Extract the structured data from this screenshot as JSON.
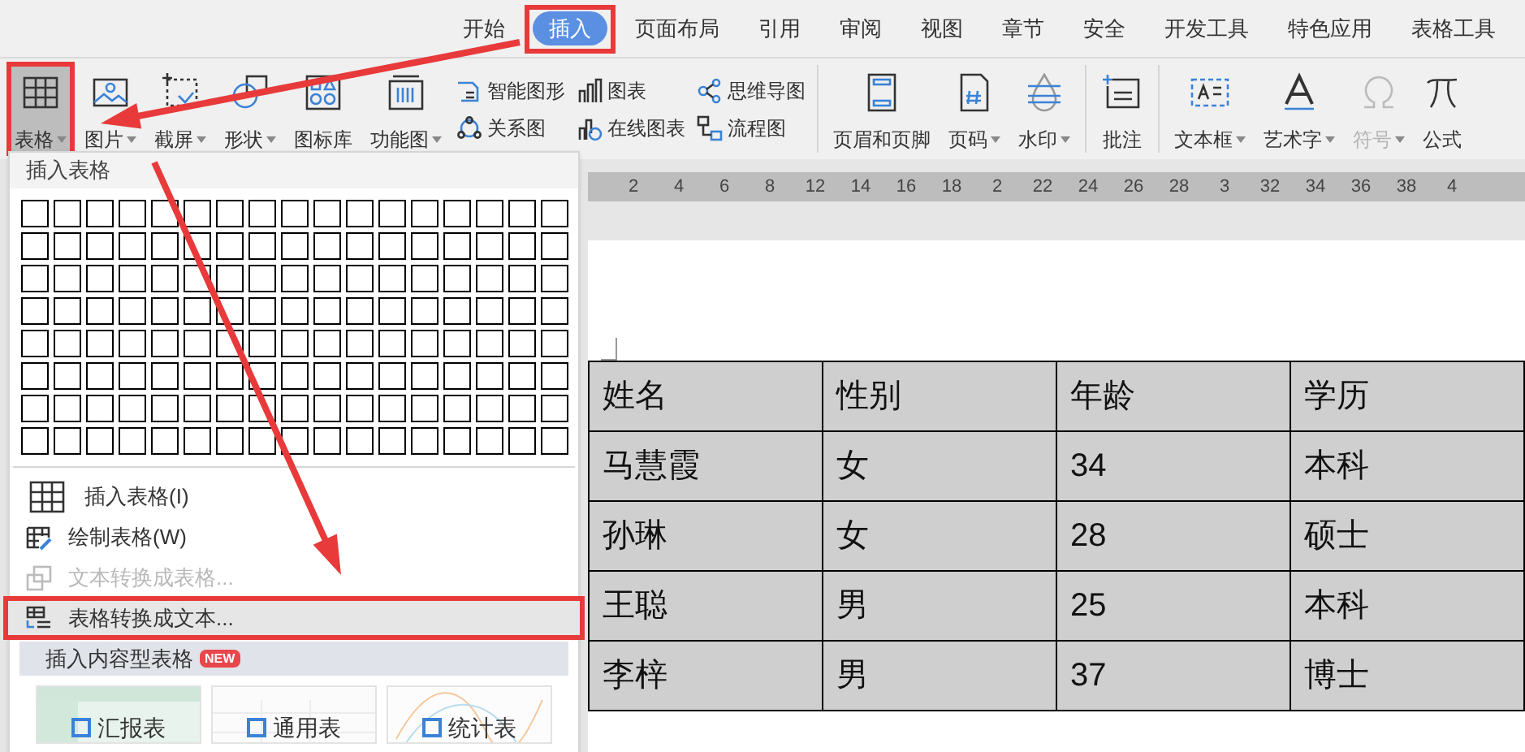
{
  "tabs": [
    {
      "label": "开始",
      "selected": false,
      "highlighted": false
    },
    {
      "label": "插入",
      "selected": true,
      "highlighted": true
    },
    {
      "label": "页面布局",
      "selected": false,
      "highlighted": false
    },
    {
      "label": "引用",
      "selected": false,
      "highlighted": false
    },
    {
      "label": "审阅",
      "selected": false,
      "highlighted": false
    },
    {
      "label": "视图",
      "selected": false,
      "highlighted": false
    },
    {
      "label": "章节",
      "selected": false,
      "highlighted": false
    },
    {
      "label": "安全",
      "selected": false,
      "highlighted": false
    },
    {
      "label": "开发工具",
      "selected": false,
      "highlighted": false
    },
    {
      "label": "特色应用",
      "selected": false,
      "highlighted": false
    },
    {
      "label": "表格工具",
      "selected": false,
      "highlighted": false
    }
  ],
  "toolbar": [
    {
      "kind": "big",
      "label": "表格",
      "caret": true,
      "pressed": true,
      "highlighted": true,
      "disabled": false
    },
    {
      "kind": "big",
      "label": "图片",
      "caret": true,
      "pressed": false,
      "highlighted": false,
      "disabled": false
    },
    {
      "kind": "big",
      "label": "截屏",
      "caret": true,
      "pressed": false,
      "highlighted": false,
      "disabled": false
    },
    {
      "kind": "big",
      "label": "形状",
      "caret": true,
      "pressed": false,
      "highlighted": false,
      "disabled": false
    },
    {
      "kind": "big",
      "label": "图标库",
      "caret": false,
      "pressed": false,
      "highlighted": false,
      "disabled": false
    },
    {
      "kind": "big",
      "label": "功能图",
      "caret": true,
      "pressed": false,
      "highlighted": false,
      "disabled": false
    },
    {
      "kind": "pair",
      "items": [
        "智能图形",
        "关系图"
      ]
    },
    {
      "kind": "pair",
      "items": [
        "图表",
        "在线图表"
      ]
    },
    {
      "kind": "pair",
      "items": [
        "思维导图",
        "流程图"
      ]
    },
    {
      "kind": "separator"
    },
    {
      "kind": "big",
      "label": "页眉和页脚",
      "caret": false,
      "pressed": false,
      "highlighted": false,
      "disabled": false
    },
    {
      "kind": "big",
      "label": "页码",
      "caret": true,
      "pressed": false,
      "highlighted": false,
      "disabled": false
    },
    {
      "kind": "big",
      "label": "水印",
      "caret": true,
      "pressed": false,
      "highlighted": false,
      "disabled": false
    },
    {
      "kind": "separator"
    },
    {
      "kind": "big",
      "label": "批注",
      "caret": false,
      "pressed": false,
      "highlighted": false,
      "disabled": false
    },
    {
      "kind": "separator"
    },
    {
      "kind": "big",
      "label": "文本框",
      "caret": true,
      "pressed": false,
      "highlighted": false,
      "disabled": false
    },
    {
      "kind": "big",
      "label": "艺术字",
      "caret": true,
      "pressed": false,
      "highlighted": false,
      "disabled": false
    },
    {
      "kind": "big",
      "label": "符号",
      "caret": true,
      "pressed": false,
      "highlighted": false,
      "disabled": true
    },
    {
      "kind": "big",
      "label": "公式",
      "caret": false,
      "pressed": false,
      "highlighted": false,
      "disabled": false
    }
  ],
  "ruler": [
    "2",
    "4",
    "6",
    "8",
    "12",
    "14",
    "16",
    "18",
    "2",
    "22",
    "24",
    "26",
    "28",
    "3",
    "32",
    "34",
    "36",
    "38",
    "4"
  ],
  "menu": {
    "title": "插入表格",
    "items": [
      {
        "label": "插入表格(I)",
        "disabled": false,
        "highlighted": false
      },
      {
        "label": "绘制表格(W)",
        "disabled": false,
        "highlighted": false
      },
      {
        "label": "文本转换成表格...",
        "disabled": true,
        "highlighted": false
      },
      {
        "label": "表格转换成文本...",
        "disabled": false,
        "highlighted": true
      }
    ],
    "section": {
      "label": "插入内容型表格",
      "badge": "NEW"
    },
    "templates": [
      {
        "kind": "report",
        "label": "汇报表"
      },
      {
        "kind": "general",
        "label": "通用表"
      },
      {
        "kind": "stats",
        "label": "统计表"
      }
    ]
  },
  "table": {
    "rows": [
      [
        "姓名",
        "性别",
        "年龄",
        "学历"
      ],
      [
        "马慧霞",
        "女",
        "34",
        "本科"
      ],
      [
        "孙琳",
        "女",
        "28",
        "硕士"
      ],
      [
        "王聪",
        "男",
        "25",
        "本科"
      ],
      [
        "李梓",
        "男",
        "37",
        "博士"
      ]
    ]
  }
}
